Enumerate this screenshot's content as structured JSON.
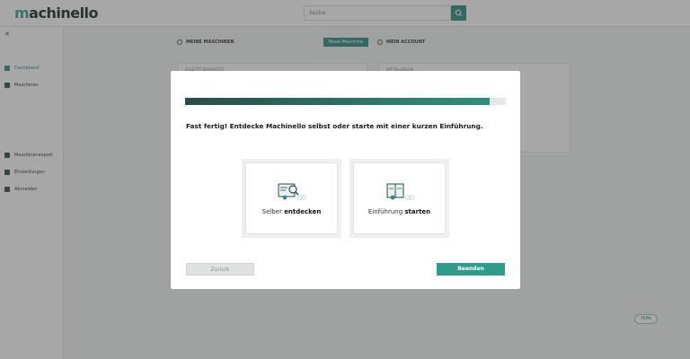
{
  "header": {
    "logo": "machinello",
    "search_placeholder": "Suche"
  },
  "sidebar": {
    "items": [
      {
        "label": "Dashboard"
      },
      {
        "label": "Maschinen"
      },
      {
        "label": "Maschinenexport"
      },
      {
        "label": "Einstellungen"
      },
      {
        "label": "Abmelden"
      }
    ]
  },
  "background": {
    "my_machines_title": "MEINE MASCHINEN",
    "new_machine_button": "Neue Maschine",
    "my_account_title": "MEIN ACCOUNT",
    "recent_label": "ZULETZT BEARBEITET",
    "messages_label": "MITTEILUNGEN",
    "help_button": "Hilfe"
  },
  "modal": {
    "progress_percent": 95,
    "title": "Fast fertig! Entdecke Machinello selbst  oder starte mit einer kurzen Einführung.",
    "options": [
      {
        "prefix": "Selber ",
        "emph": "entdecken"
      },
      {
        "prefix": "Einführung ",
        "emph": "starten"
      }
    ],
    "back_button": "Zurück",
    "finish_button": "Beenden"
  },
  "colors": {
    "accent": "#2f8f82",
    "accent_dark": "#2a4c4a"
  }
}
